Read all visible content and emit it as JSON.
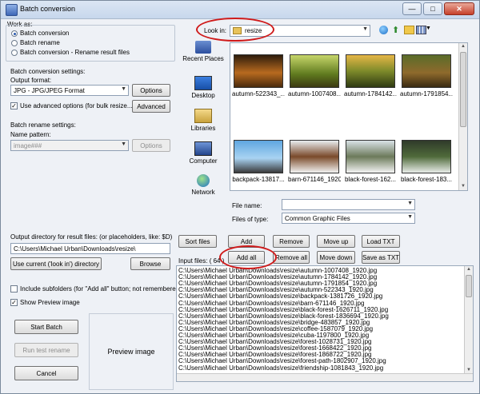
{
  "window": {
    "title": "Batch conversion",
    "min": "—",
    "max": "□",
    "close": "✕"
  },
  "work_as": {
    "label": "Work as:",
    "options": [
      "Batch conversion",
      "Batch rename",
      "Batch conversion - Rename result files"
    ],
    "selected": 0
  },
  "conversion_settings": {
    "label": "Batch conversion settings:",
    "output_format_label": "Output format:",
    "output_format_value": "JPG - JPG/JPEG Format",
    "options_button": "Options",
    "advanced_checkbox_label": "Use advanced options (for bulk resize...)",
    "advanced_checked": true,
    "advanced_button": "Advanced"
  },
  "rename_settings": {
    "label": "Batch rename settings:",
    "name_pattern_label": "Name pattern:",
    "name_pattern_value": "image###",
    "options_button": "Options"
  },
  "output_dir": {
    "label": "Output directory for result files: (or placeholders, like: $D)",
    "value": "C:\\Users\\Michael Urban\\Downloads\\resize\\",
    "use_current_button": "Use current ('look in') directory",
    "browse_button": "Browse"
  },
  "include_subfolders": {
    "label": "Include subfolders (for \"Add all\" button; not remembered)",
    "checked": false
  },
  "show_preview": {
    "label": "Show Preview image",
    "checked": true
  },
  "actions": {
    "start": "Start Batch",
    "run_test": "Run test rename",
    "cancel": "Cancel"
  },
  "preview_label": "Preview image",
  "look_in": {
    "label": "Look in:",
    "value": "resize"
  },
  "places": [
    "Recent Places",
    "Desktop",
    "Libraries",
    "Computer",
    "Network"
  ],
  "thumbnails": [
    {
      "name": "autumn-522343_..."
    },
    {
      "name": "autumn-1007408..."
    },
    {
      "name": "autumn-1784142..."
    },
    {
      "name": "autumn-1791854..."
    },
    {
      "name": "backpack-13817..."
    },
    {
      "name": "barn-671146_1920"
    },
    {
      "name": "black-forest-162..."
    },
    {
      "name": "black-forest-183..."
    }
  ],
  "file_name_label": "File name:",
  "file_name_value": "",
  "files_of_type_label": "Files of type:",
  "files_of_type_value": "Common Graphic Files",
  "list_buttons": {
    "sort": "Sort files",
    "add": "Add",
    "remove": "Remove",
    "move_up": "Move up",
    "load_txt": "Load TXT",
    "add_all": "Add all",
    "remove_all": "Remove all",
    "move_down": "Move down",
    "save_txt": "Save as TXT"
  },
  "input_files_label": "Input files: ( 64 )",
  "input_files": [
    "C:\\Users\\Michael Urban\\Downloads\\resize\\autumn-1007408_1920.jpg",
    "C:\\Users\\Michael Urban\\Downloads\\resize\\autumn-1784142_1920.jpg",
    "C:\\Users\\Michael Urban\\Downloads\\resize\\autumn-1791854_1920.jpg",
    "C:\\Users\\Michael Urban\\Downloads\\resize\\autumn-522343_1920.jpg",
    "C:\\Users\\Michael Urban\\Downloads\\resize\\backpack-1381726_1920.jpg",
    "C:\\Users\\Michael Urban\\Downloads\\resize\\barn-671146_1920.jpg",
    "C:\\Users\\Michael Urban\\Downloads\\resize\\black-forest-1626711_1920.jpg",
    "C:\\Users\\Michael Urban\\Downloads\\resize\\black-forest-1836694_1920.jpg",
    "C:\\Users\\Michael Urban\\Downloads\\resize\\bridge-483857_1920.jpg",
    "C:\\Users\\Michael Urban\\Downloads\\resize\\coffee-1587079_1920.jpg",
    "C:\\Users\\Michael Urban\\Downloads\\resize\\cuba-1197800_1920.jpg",
    "C:\\Users\\Michael Urban\\Downloads\\resize\\forest-1028731_1920.jpg",
    "C:\\Users\\Michael Urban\\Downloads\\resize\\forest-1668422_1920.jpg",
    "C:\\Users\\Michael Urban\\Downloads\\resize\\forest-1868722_1920.jpg",
    "C:\\Users\\Michael Urban\\Downloads\\resize\\forest-path-1802907_1920.jpg",
    "C:\\Users\\Michael Urban\\Downloads\\resize\\friendship-1081843_1920.jpg"
  ],
  "colors": {
    "highlight_circle": "#cf1a1a",
    "window_bg": "#eef1f6"
  }
}
